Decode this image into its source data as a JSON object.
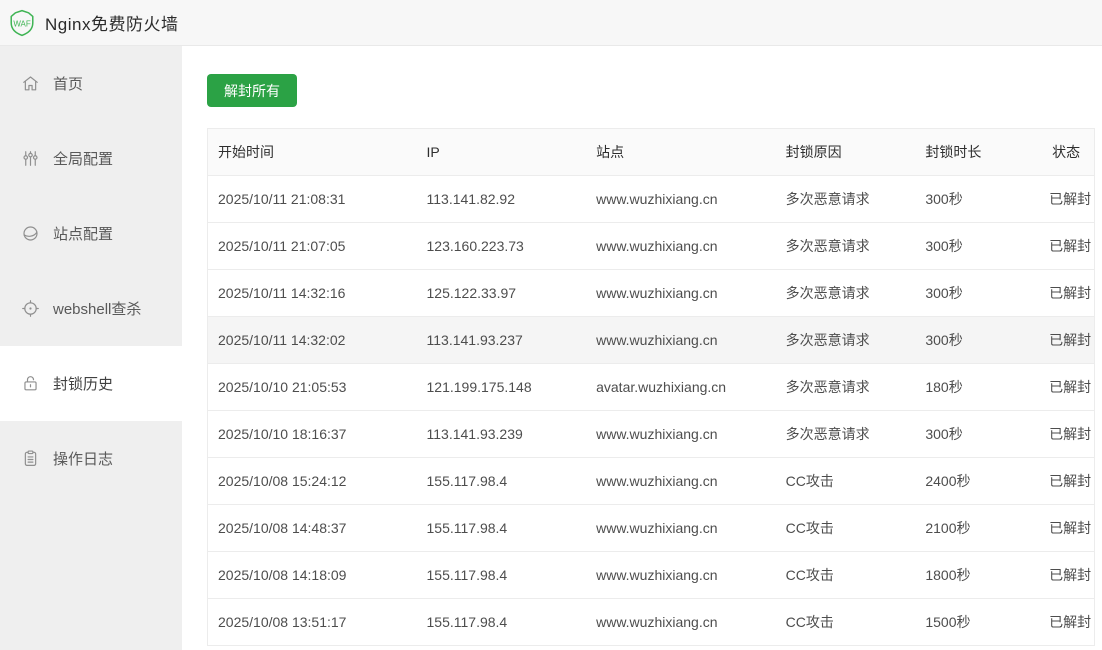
{
  "header": {
    "logo_text": "WAF",
    "title": "Nginx免费防火墙"
  },
  "colors": {
    "accent_green": "#2ba245",
    "logo_green": "#3fb454",
    "sidebar_bg": "#efefef",
    "row_hover_bg": "#f5f5f5"
  },
  "sidebar": {
    "items": [
      {
        "label": "首页",
        "icon": "home-icon",
        "selected": false
      },
      {
        "label": "全局配置",
        "icon": "sliders-icon",
        "selected": false
      },
      {
        "label": "站点配置",
        "icon": "globe-icon",
        "selected": false
      },
      {
        "label": "webshell查杀",
        "icon": "target-icon",
        "selected": false
      },
      {
        "label": "封锁历史",
        "icon": "lock-icon",
        "selected": true
      },
      {
        "label": "操作日志",
        "icon": "clipboard-icon",
        "selected": false
      }
    ]
  },
  "toolbar": {
    "unblock_all_label": "解封所有"
  },
  "table": {
    "columns": [
      "开始时间",
      "IP",
      "站点",
      "封锁原因",
      "封锁时长",
      "状态"
    ],
    "rows": [
      {
        "time": "2025/10/11 21:08:31",
        "ip": "113.141.82.92",
        "site": "www.wuzhixiang.cn",
        "reason": "多次恶意请求",
        "duration": "300秒",
        "status": "已解封",
        "highlighted": false
      },
      {
        "time": "2025/10/11 21:07:05",
        "ip": "123.160.223.73",
        "site": "www.wuzhixiang.cn",
        "reason": "多次恶意请求",
        "duration": "300秒",
        "status": "已解封",
        "highlighted": false
      },
      {
        "time": "2025/10/11 14:32:16",
        "ip": "125.122.33.97",
        "site": "www.wuzhixiang.cn",
        "reason": "多次恶意请求",
        "duration": "300秒",
        "status": "已解封",
        "highlighted": false
      },
      {
        "time": "2025/10/11 14:32:02",
        "ip": "113.141.93.237",
        "site": "www.wuzhixiang.cn",
        "reason": "多次恶意请求",
        "duration": "300秒",
        "status": "已解封",
        "highlighted": true
      },
      {
        "time": "2025/10/10 21:05:53",
        "ip": "121.199.175.148",
        "site": "avatar.wuzhixiang.cn",
        "reason": "多次恶意请求",
        "duration": "180秒",
        "status": "已解封",
        "highlighted": false
      },
      {
        "time": "2025/10/10 18:16:37",
        "ip": "113.141.93.239",
        "site": "www.wuzhixiang.cn",
        "reason": "多次恶意请求",
        "duration": "300秒",
        "status": "已解封",
        "highlighted": false
      },
      {
        "time": "2025/10/08 15:24:12",
        "ip": "155.117.98.4",
        "site": "www.wuzhixiang.cn",
        "reason": "CC攻击",
        "duration": "2400秒",
        "status": "已解封",
        "highlighted": false
      },
      {
        "time": "2025/10/08 14:48:37",
        "ip": "155.117.98.4",
        "site": "www.wuzhixiang.cn",
        "reason": "CC攻击",
        "duration": "2100秒",
        "status": "已解封",
        "highlighted": false
      },
      {
        "time": "2025/10/08 14:18:09",
        "ip": "155.117.98.4",
        "site": "www.wuzhixiang.cn",
        "reason": "CC攻击",
        "duration": "1800秒",
        "status": "已解封",
        "highlighted": false
      },
      {
        "time": "2025/10/08 13:51:17",
        "ip": "155.117.98.4",
        "site": "www.wuzhixiang.cn",
        "reason": "CC攻击",
        "duration": "1500秒",
        "status": "已解封",
        "highlighted": false
      }
    ]
  }
}
